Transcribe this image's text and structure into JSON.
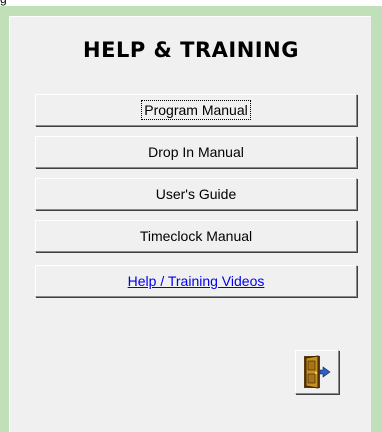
{
  "window": {
    "title_fragment": "g"
  },
  "panel": {
    "title": "HELP & TRAINING"
  },
  "buttons": [
    {
      "label": "Program Manual",
      "focused": true
    },
    {
      "label": "Drop In Manual",
      "focused": false
    },
    {
      "label": "User's Guide",
      "focused": false
    },
    {
      "label": "Timeclock Manual",
      "focused": false
    },
    {
      "label": "Help / Training Videos",
      "focused": false,
      "style": "link"
    }
  ],
  "exit_button": {
    "icon": "exit-door-icon"
  },
  "colors": {
    "panel_background": "#bfe0b9",
    "content_background": "#f0f0f0",
    "link": "#0000ee"
  }
}
